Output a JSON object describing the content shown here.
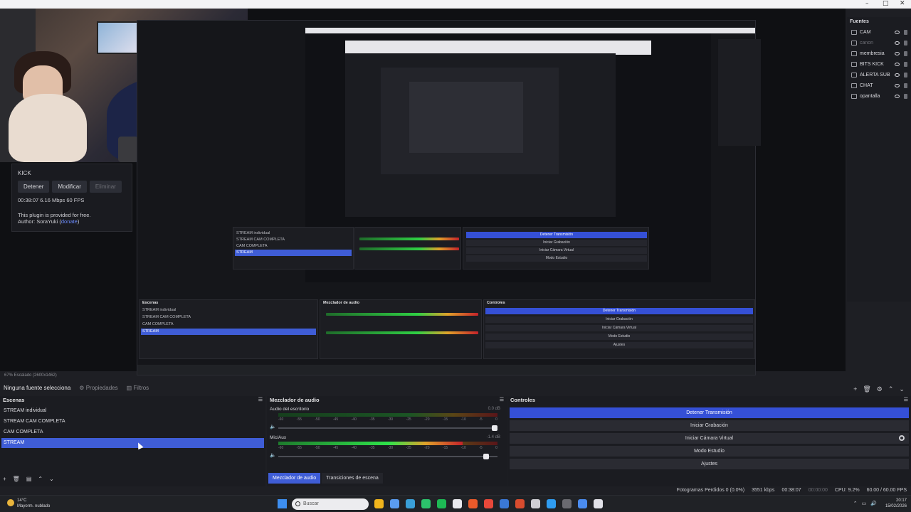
{
  "window": {
    "controls": [
      "–",
      "□",
      "✕"
    ]
  },
  "plugin": {
    "title": "KICK",
    "buttons": {
      "stop": "Detener",
      "modify": "Modificar",
      "delete": "Eliminar"
    },
    "stats": "00:38:07  6.16 Mbps  60 FPS",
    "free_text": "This plugin is provided for free.",
    "author_label": "Author: SoraYuki (",
    "author_link": "donate",
    "author_close": ")"
  },
  "sources": {
    "header": "Fuentes",
    "items": [
      {
        "label": "CAM",
        "dim": false
      },
      {
        "label": "canon",
        "dim": true
      },
      {
        "label": "membresia",
        "dim": false
      },
      {
        "label": "BITS KICK",
        "dim": false
      },
      {
        "label": "ALERTA SUB",
        "dim": false
      },
      {
        "label": "CHAT",
        "dim": false
      },
      {
        "label": "opantalla",
        "dim": false
      }
    ],
    "toolbar": [
      "+",
      "🗑",
      "⚙",
      "⌃",
      "⌄"
    ]
  },
  "preview": {
    "zoom_status": "67%   Escalado (2600x1462)"
  },
  "context_bar": {
    "no_source": "Ninguna fuente selecciona",
    "properties": "Propiedades",
    "filters": "Filtros"
  },
  "scenes": {
    "title": "Escenas",
    "items": [
      {
        "label": "STREAM individual",
        "selected": false
      },
      {
        "label": "STREAM CAM COMPLETA",
        "selected": false
      },
      {
        "label": "CAM COMPLETA",
        "selected": false
      },
      {
        "label": "STREAM",
        "selected": true
      }
    ],
    "toolbar": [
      "+",
      "🗑",
      "▤",
      "⌃",
      "⌄"
    ]
  },
  "mixer": {
    "title": "Mezclador de audio",
    "tracks": [
      {
        "label": "Audio del escritorio",
        "db": "0.0 dB",
        "level": 0,
        "volume": 1.0
      },
      {
        "label": "Mic/Aux",
        "db": "-1.4 dB",
        "level": 0.84,
        "volume": 0.96
      }
    ],
    "ticks": [
      "-60",
      "-55",
      "-50",
      "-45",
      "-40",
      "-35",
      "-30",
      "-25",
      "-20",
      "-15",
      "-10",
      "-5",
      "0"
    ],
    "tabs": [
      {
        "label": "Mezclador de audio",
        "active": true
      },
      {
        "label": "Transiciones de escena",
        "active": false
      }
    ]
  },
  "controls": {
    "title": "Controles",
    "buttons": [
      {
        "label": "Detener Transmisión",
        "primary": true,
        "gear": false
      },
      {
        "label": "Iniciar Grabación",
        "primary": false,
        "gear": false
      },
      {
        "label": "Iniciar Cámara Virtual",
        "primary": false,
        "gear": true
      },
      {
        "label": "Modo Estudio",
        "primary": false,
        "gear": false
      },
      {
        "label": "Ajustes",
        "primary": false,
        "gear": false
      }
    ]
  },
  "status": {
    "dropped": "Fotogramas Perdidos 0 (0.0%)",
    "bitrate": "3551 kbps",
    "stream_time": "00:38:07",
    "rec_time": "00:00:00",
    "cpu": "CPU: 9.2%",
    "fps": "60.00 / 60.00 FPS"
  },
  "nested": {
    "scenes": [
      "STREAM individual",
      "STREAM CAM COMPLETA",
      "CAM COMPLETA",
      "STREAM"
    ],
    "controls": [
      "Detener Transmisión",
      "Iniciar Grabación",
      "Iniciar Cámara Virtual",
      "Modo Estudio",
      "Ajustes"
    ],
    "titles": {
      "scenes": "Escenas",
      "mixer": "Mezclador de audio",
      "controls": "Controles"
    }
  },
  "taskbar": {
    "weather_temp": "14°C",
    "weather_desc": "Mayorm. nublado",
    "search_placeholder": "Buscar",
    "time": "20:17",
    "date": "15/02/2026",
    "app_colors": [
      "#f1b51c",
      "#5a9cf0",
      "#3aa0d8",
      "#2cc36b",
      "#1db954",
      "#e9e9ee",
      "#ea5a2a",
      "#e8483a",
      "#3a78d6",
      "#d94c2e",
      "#cfcfd4",
      "#2f9cf0",
      "#6a6a70",
      "#4a8cf0",
      "#e2e2e8"
    ]
  }
}
